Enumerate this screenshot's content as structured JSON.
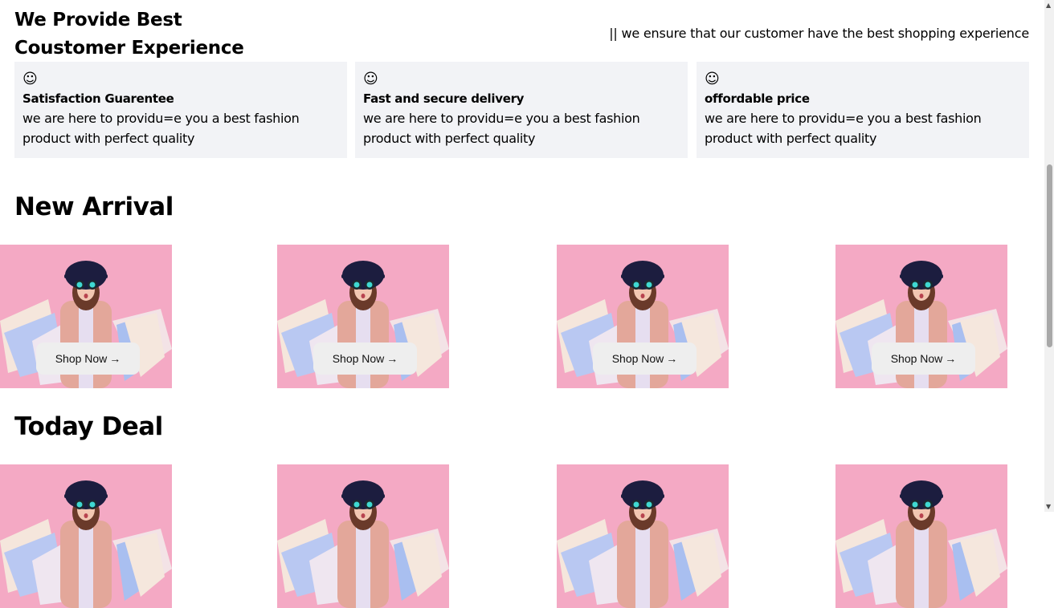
{
  "header": {
    "title_line1": "We Provide Best",
    "title_line2": "Coustomer Experience",
    "tagline": "|| we ensure that our customer have the best shopping experience"
  },
  "features": [
    {
      "icon": "☺",
      "title": "Satisfaction Guarentee",
      "desc": "we are here to providu=e you a best fashion product with perfect quality"
    },
    {
      "icon": "☺",
      "title": "Fast and secure delivery",
      "desc": "we are here to providu=e you a best fashion product with perfect quality"
    },
    {
      "icon": "☺",
      "title": "offordable price",
      "desc": "we are here to providu=e you a best fashion product with perfect quality"
    }
  ],
  "new_arrival": {
    "title": "New Arrival",
    "button": "Shop Now",
    "arrow": "→"
  },
  "today_deal": {
    "title": "Today Deal"
  }
}
